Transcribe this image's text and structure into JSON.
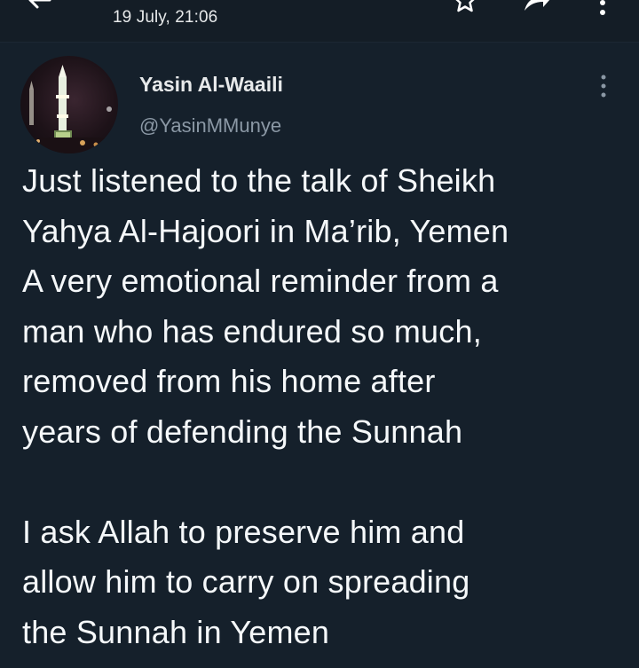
{
  "header": {
    "timestamp": "19 July, 21:06",
    "icons": [
      "back-arrow-icon",
      "star-icon",
      "share-icon",
      "overflow-menu-icon"
    ]
  },
  "tweet": {
    "author": {
      "display_name": "Yasin Al-Waaili",
      "handle": "@YasinMMunye",
      "avatar": "avatar-minaret-night"
    },
    "more_icon": "more-vertical-icon",
    "paragraph_1": "Just listened to the talk of Sheikh\nYahya Al-Hajoori in Ma’rib, Yemen\nA very emotional reminder from a\nman who has endured so much,\nremoved from his home after\nyears of defending the Sunnah",
    "paragraph_2": "I ask Allah to preserve him and\nallow him to carry on spreading\nthe Sunnah in Yemen"
  },
  "colors": {
    "background": "#15202b",
    "header_background": "#141d26",
    "primary_text": "#f5f8fa",
    "secondary_text": "#8b98a5"
  }
}
